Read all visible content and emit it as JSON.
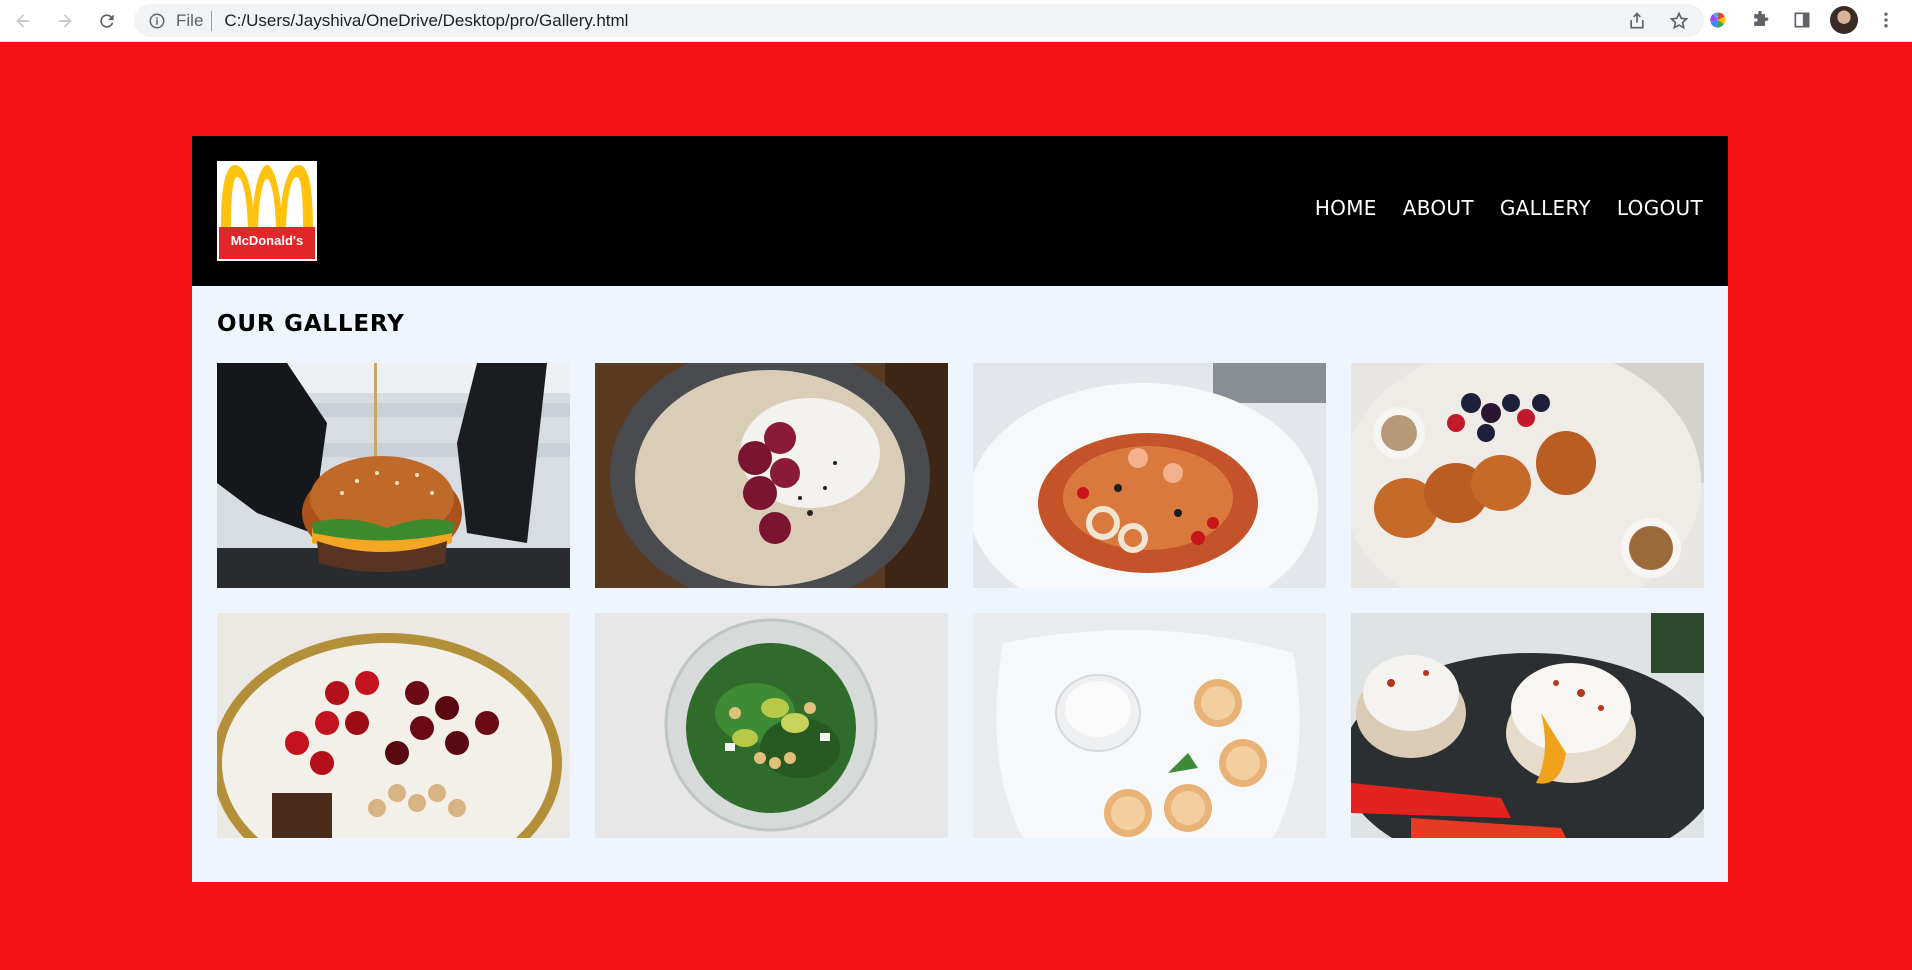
{
  "browser": {
    "file_label": "File",
    "url": "C:/Users/Jayshiva/OneDrive/Desktop/pro/Gallery.html"
  },
  "colors": {
    "page_background": "#f41313",
    "header_background": "#000000",
    "content_background": "#eef5fc",
    "nav_text": "#ffffff"
  },
  "logo": {
    "text": "McDonald's"
  },
  "nav": {
    "items": [
      {
        "label": "HOME"
      },
      {
        "label": "ABOUT"
      },
      {
        "label": "GALLERY"
      },
      {
        "label": "LOGOUT"
      }
    ]
  },
  "gallery": {
    "title": "OUR GALLERY",
    "images": [
      {
        "subject": "burger"
      },
      {
        "subject": "oatmeal with raspberries"
      },
      {
        "subject": "seafood pasta"
      },
      {
        "subject": "pancakes with berries"
      },
      {
        "subject": "cherries and strawberries"
      },
      {
        "subject": "salad bowl"
      },
      {
        "subject": "cheese pancakes with cream"
      },
      {
        "subject": "poached eggs"
      }
    ]
  }
}
